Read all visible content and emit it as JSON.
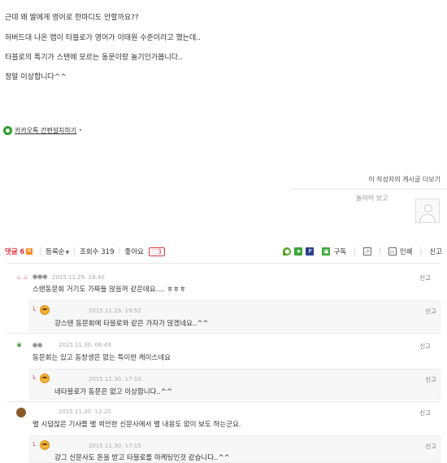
{
  "post": {
    "cut_line": "",
    "lines": [
      "근데 왜 딸에게 영어로 한마디도 안할까요??",
      "하버드대 나온 랩이 타블로가 영어가 이태원 수준이라고 했는데..",
      "타블로의 특기가 스탠에 모르는 동문이랑 놀기인가봅니다..",
      "정말 이상합니다^^"
    ],
    "kakao_link": "카카오톡 간편설치하기",
    "more_by_author": "이 작성자의 게시글 더보기",
    "author_name": "놀이어 보고"
  },
  "bar": {
    "comments_label": "댓글",
    "comments_count": "6",
    "new_badge": "N",
    "sort_label": "등록순",
    "views_label": "조회수 319",
    "like_label": "좋아요",
    "like_count": "3",
    "subscribe_label": "구독",
    "print_label": "인쇄",
    "report_label": "신고"
  },
  "comments": [
    {
      "kind": "comment",
      "date": "2015.11.29. 18:40",
      "text": "스탠동문회 거기도 가짜들 많을꺼 같은데요.... ㅎㅎㅎ",
      "report": "신고"
    },
    {
      "kind": "reply",
      "nick": "",
      "date": "2015.11.29. 19:52",
      "text": "걍스탠 동문회에 타블로와 같은 가자가 많겠네요..^^",
      "report": "신고"
    },
    {
      "kind": "comment",
      "date": "2015.11.30. 06:49",
      "text": "동문회는 있고 동창생은 없는 특이한 케이스네요",
      "report": "신고"
    },
    {
      "kind": "reply",
      "nick": "",
      "date": "2015.11.30. 17:10",
      "text": "네타블로가 동문은 없고 이상합니다..^^",
      "report": "신고"
    },
    {
      "kind": "comment",
      "nick": "",
      "date": "2015.11.30. 12:20",
      "text": "별 시덥잖은 기사를 별 희안한 신문사에서 별 내용도 없이 보도 하는군요.",
      "report": "신고"
    },
    {
      "kind": "reply",
      "nick": "",
      "date": "2015.11.30. 17:15",
      "text": "걍그 신문사도 돈을 받고 타블로를 마케팅인것 같습니다..^^",
      "report": "신고"
    }
  ],
  "colors": {
    "accent": "#e0333f",
    "green": "#2a9d2a",
    "gray_border": "#e8e8e8"
  },
  "icons": [
    "kakao-icon",
    "pin-icon",
    "star-icon",
    "blog-icon",
    "rss-icon",
    "share-icon",
    "print-icon"
  ]
}
